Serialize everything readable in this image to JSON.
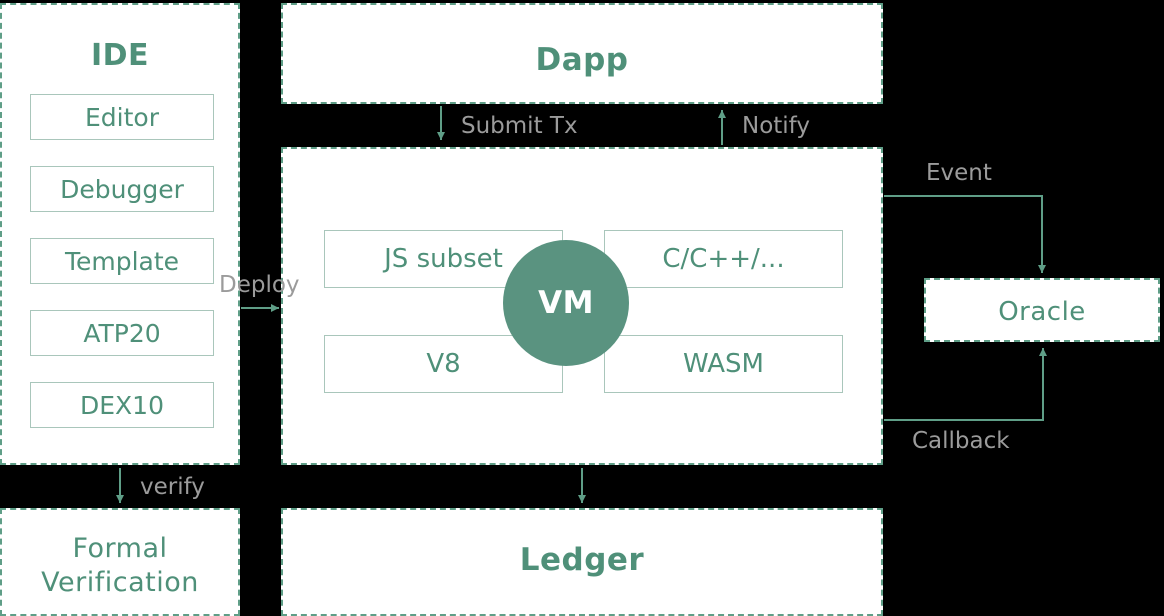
{
  "colors": {
    "accent": "#4f9079",
    "panel_border": "#5f9e87",
    "inner_border": "#a9c6bb",
    "vm_circle": "#5a9380",
    "label_text": "#9b9b9b",
    "background": "#000000",
    "panel_fill": "#ffffff"
  },
  "ide": {
    "title": "IDE",
    "items": [
      {
        "label": "Editor"
      },
      {
        "label": "Debugger"
      },
      {
        "label": "Template"
      },
      {
        "label": "ATP20"
      },
      {
        "label": "DEX10"
      }
    ]
  },
  "dapp": {
    "title": "Dapp"
  },
  "vm": {
    "core_label": "VM",
    "slots": [
      {
        "label": "JS subset"
      },
      {
        "label": "C/C++/..."
      },
      {
        "label": "V8"
      },
      {
        "label": "WASM"
      }
    ]
  },
  "oracle": {
    "title": "Oracle"
  },
  "formal_verification": {
    "title": "Formal\nVerification",
    "line1": "Formal",
    "line2": "Verification"
  },
  "ledger": {
    "title": "Ledger"
  },
  "connectors": [
    {
      "name": "submit-tx",
      "label": "Submit Tx",
      "direction": "down",
      "from": "dapp",
      "to": "vm"
    },
    {
      "name": "notify",
      "label": "Notify",
      "direction": "up",
      "from": "vm",
      "to": "dapp"
    },
    {
      "name": "deploy",
      "label": "Deploy",
      "direction": "right",
      "from": "ide",
      "to": "vm"
    },
    {
      "name": "verify",
      "label": "verify",
      "direction": "down",
      "from": "ide",
      "to": "formal-verification"
    },
    {
      "name": "event",
      "label": "Event",
      "direction": "right-down",
      "from": "vm",
      "to": "oracle"
    },
    {
      "name": "callback",
      "label": "Callback",
      "direction": "right-up",
      "from": "vm",
      "to": "oracle"
    },
    {
      "name": "ledger-write",
      "label": "",
      "direction": "down",
      "from": "vm",
      "to": "ledger"
    }
  ]
}
